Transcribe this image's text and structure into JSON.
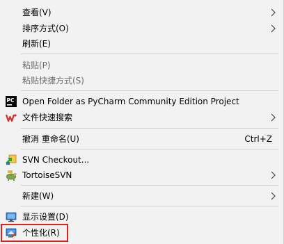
{
  "menu": {
    "items": [
      {
        "label": "查看(V)"
      },
      {
        "label": "排序方式(O)"
      },
      {
        "label": "刷新(E)"
      },
      {
        "label": "粘贴(P)"
      },
      {
        "label": "粘贴快捷方式(S)"
      },
      {
        "label": "Open Folder as PyCharm Community Edition Project"
      },
      {
        "label": "文件快速搜索"
      },
      {
        "label": "撤消 重命名(U)",
        "shortcut": "Ctrl+Z"
      },
      {
        "label": "SVN Checkout..."
      },
      {
        "label": "TortoiseSVN"
      },
      {
        "label": "新建(W)"
      },
      {
        "label": "显示设置(D)"
      },
      {
        "label": "个性化(R)"
      }
    ]
  },
  "colors": {
    "menu_background": "#f2f2f2",
    "disabled_text": "#6d6d6d",
    "highlight_border": "#e0201b"
  },
  "icons": [
    "chevron-right-icon",
    "pycharm-icon",
    "wps-icon",
    "svn-checkout-icon",
    "tortoisesvn-icon",
    "display-settings-icon",
    "personalize-icon"
  ]
}
